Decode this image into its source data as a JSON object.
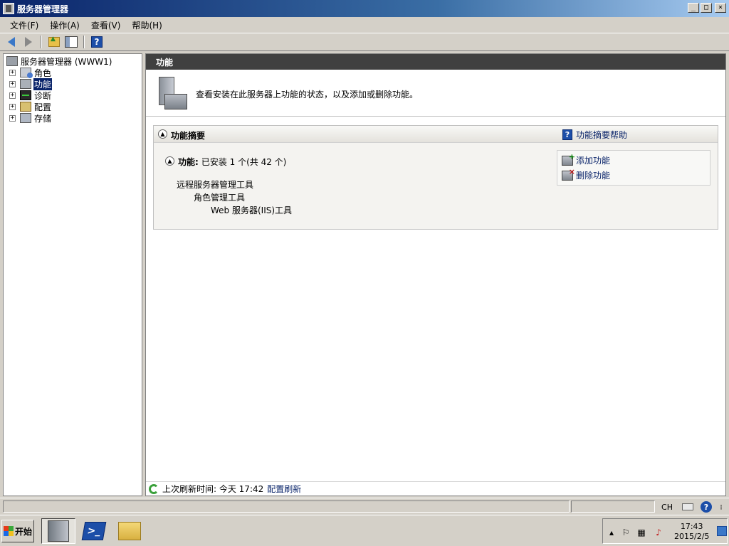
{
  "window": {
    "title": "服务器管理器",
    "min": "_",
    "max": "□",
    "close": "×"
  },
  "menu": [
    {
      "label": "文件(F)"
    },
    {
      "label": "操作(A)"
    },
    {
      "label": "查看(V)"
    },
    {
      "label": "帮助(H)"
    }
  ],
  "tree": {
    "root": "服务器管理器 (WWW1)",
    "items": [
      {
        "label": "角色",
        "icon": "roles-icon"
      },
      {
        "label": "功能",
        "icon": "features-icon",
        "selected": true
      },
      {
        "label": "诊断",
        "icon": "diagnostics-icon"
      },
      {
        "label": "配置",
        "icon": "configuration-icon"
      },
      {
        "label": "存储",
        "icon": "storage-icon"
      }
    ],
    "expander": "+"
  },
  "content": {
    "header": "功能",
    "intro": "查看安装在此服务器上功能的状态，以及添加或删除功能。",
    "summary": {
      "title": "功能摘要",
      "help_link": "功能摘要帮助",
      "features_label": "功能:",
      "features_status": "已安装 1 个(共 42 个)",
      "installed": [
        {
          "label": "远程服务器管理工具",
          "level": 0
        },
        {
          "label": "角色管理工具",
          "level": 1
        },
        {
          "label": "Web 服务器(IIS)工具",
          "level": 2
        }
      ],
      "actions": [
        {
          "label": "添加功能",
          "icon": "add-feature-icon"
        },
        {
          "label": "删除功能",
          "icon": "remove-feature-icon"
        }
      ]
    },
    "status": {
      "label": "上次刷新时间: 今天 17:42",
      "link": "配置刷新"
    }
  },
  "statusbar": {
    "lang": "CH"
  },
  "taskbar": {
    "start": "开始",
    "clock_time": "17:43",
    "clock_date": "2015/2/5"
  },
  "colors": {
    "accent": "#0a246a",
    "header_dark": "#404040",
    "link": "#0a246a"
  }
}
